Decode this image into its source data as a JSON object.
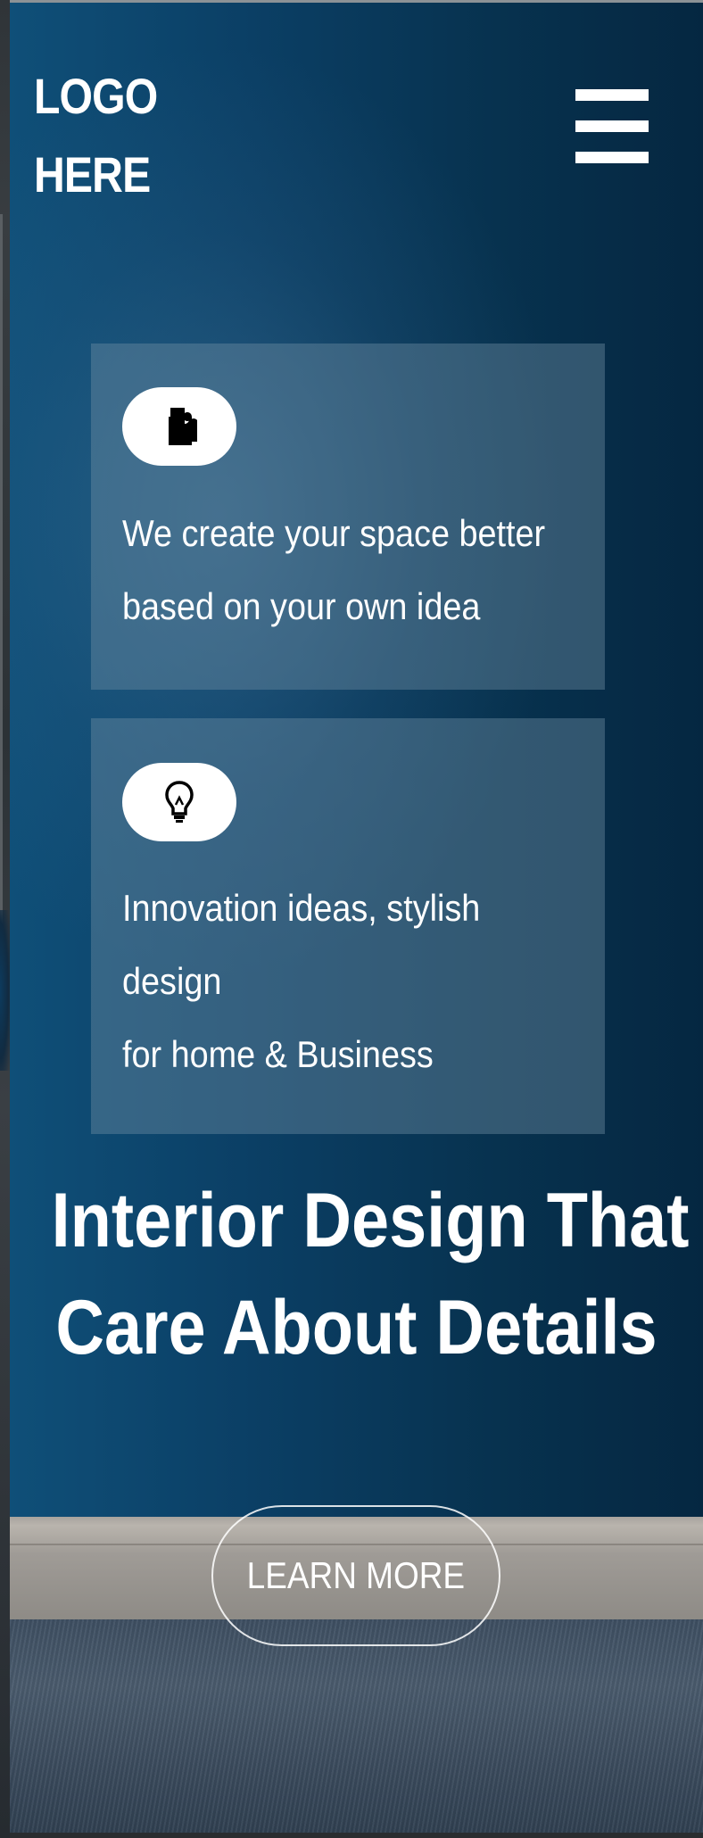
{
  "header": {
    "logo_line1": "LOGO",
    "logo_line2": "HERE",
    "menu_icon": "hamburger-menu-icon"
  },
  "features": [
    {
      "icon": "puzzle-piece-icon",
      "lines": [
        "We create your space better",
        "based on your own idea"
      ]
    },
    {
      "icon": "lightbulb-icon",
      "lines": [
        "Innovation ideas, stylish",
        "design",
        "for home & Business"
      ]
    }
  ],
  "hero": {
    "headline_line1": "Interior Design That",
    "headline_line2": "Care About Details",
    "cta_label": "LEARN MORE"
  },
  "colors": {
    "hero_blue": "#0b3f65",
    "card_overlay": "#708ea5",
    "text": "#ffffff"
  }
}
